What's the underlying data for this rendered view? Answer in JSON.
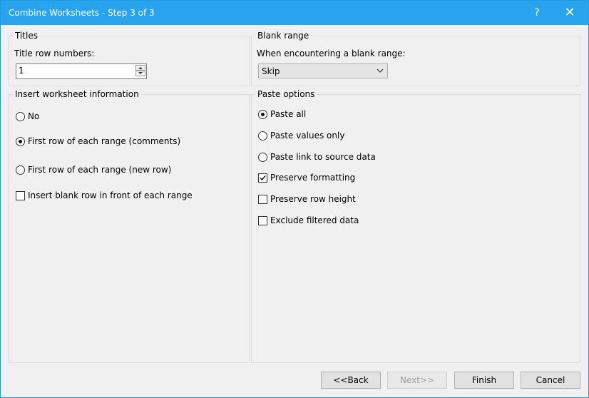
{
  "window": {
    "title": "Combine Worksheets - Step 3 of 3",
    "help_glyph": "?",
    "close_glyph": "✕"
  },
  "titles": {
    "legend": "Titles",
    "row_numbers_label": "Title row numbers:",
    "row_numbers_value": "1"
  },
  "blank_range": {
    "legend": "Blank range",
    "prompt": "When encountering a blank range:",
    "selected": "Skip"
  },
  "insert_info": {
    "legend": "Insert worksheet information",
    "options": [
      {
        "label": "No",
        "checked": false
      },
      {
        "label": "First row of each range (comments)",
        "checked": true
      },
      {
        "label": "First row of each range (new row)",
        "checked": false
      }
    ],
    "blank_row_label": "Insert blank row in front of each range",
    "blank_row_checked": false
  },
  "paste_options": {
    "legend": "Paste options",
    "radios": [
      {
        "label": "Paste all",
        "checked": true
      },
      {
        "label": "Paste values only",
        "checked": false
      },
      {
        "label": "Paste link to source data",
        "checked": false
      }
    ],
    "checks": [
      {
        "label": "Preserve formatting",
        "checked": true
      },
      {
        "label": "Preserve row height",
        "checked": false
      },
      {
        "label": "Exclude filtered data",
        "checked": false
      }
    ]
  },
  "buttons": {
    "back": "<<Back",
    "next": "Next>>",
    "finish": "Finish",
    "cancel": "Cancel"
  },
  "colors": {
    "titlebar": "#27a4ed",
    "dialog_bg": "#f0f0f0"
  }
}
